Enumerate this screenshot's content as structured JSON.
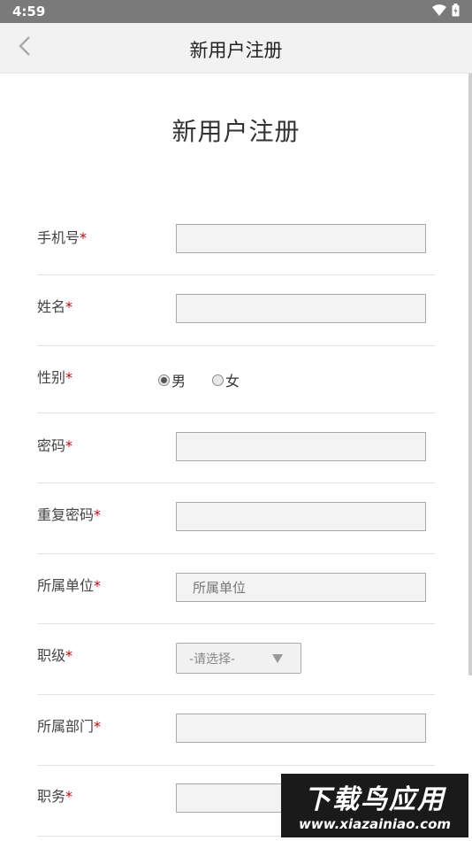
{
  "status_bar": {
    "time": "4:59"
  },
  "nav": {
    "title": "新用户注册"
  },
  "page": {
    "heading": "新用户注册"
  },
  "form": {
    "required_mark": "*",
    "phone": {
      "label": "手机号",
      "value": ""
    },
    "name": {
      "label": "姓名",
      "value": ""
    },
    "gender": {
      "label": "性别",
      "options": [
        "男",
        "女"
      ],
      "selected": "男"
    },
    "password": {
      "label": "密码",
      "value": ""
    },
    "confirm_password": {
      "label": "重复密码",
      "value": ""
    },
    "organization": {
      "label": "所属单位",
      "placeholder": "所属单位"
    },
    "rank": {
      "label": "职级",
      "selected": "-请选择-"
    },
    "department": {
      "label": "所属部门",
      "value": ""
    },
    "position": {
      "label": "职务",
      "value": ""
    }
  },
  "watermark": {
    "brand": "下载鸟应用",
    "url": "www.xiazainiao.com"
  }
}
